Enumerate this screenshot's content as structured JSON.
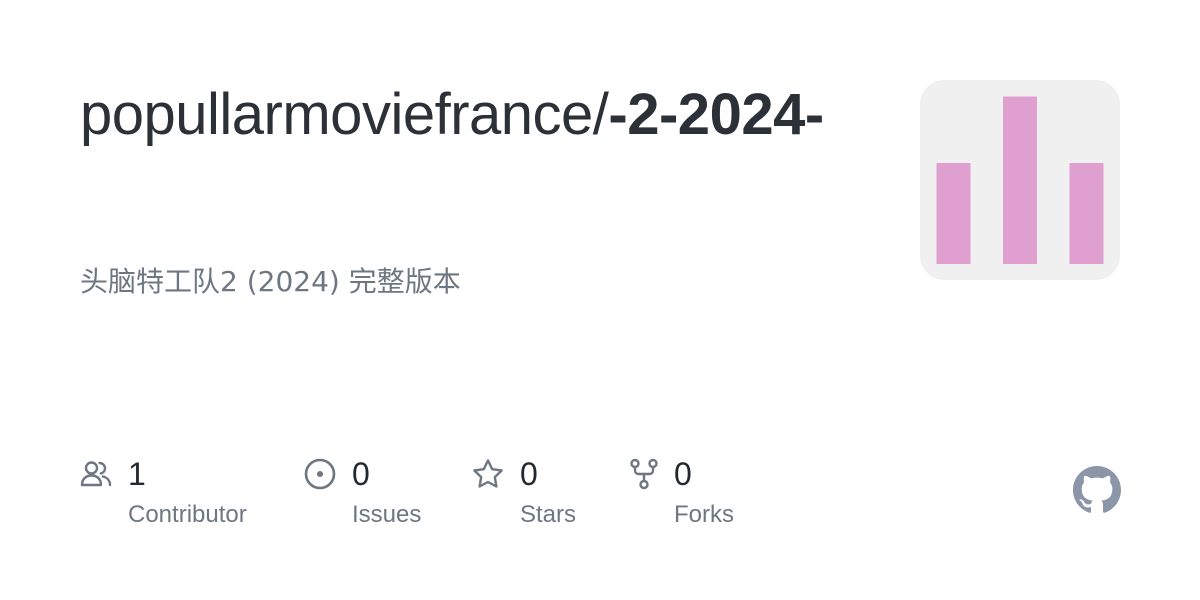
{
  "repo": {
    "owner": "popullarmoviefrance",
    "separator": "/",
    "name": "-2-2024-",
    "description": "头脑特工队2 (2024) 完整版本"
  },
  "avatar": {
    "icon": "bar-graph-avatar",
    "background": "#f0f0f0",
    "bar_color": "#df9fcf"
  },
  "stats": {
    "contributors": {
      "count": "1",
      "label": "Contributor",
      "icon": "people-icon"
    },
    "issues": {
      "count": "0",
      "label": "Issues",
      "icon": "issue-opened-icon"
    },
    "stars": {
      "count": "0",
      "label": "Stars",
      "icon": "star-icon"
    },
    "forks": {
      "count": "0",
      "label": "Forks",
      "icon": "repo-forked-icon"
    }
  },
  "brand": {
    "icon": "github-mark-icon",
    "color": "#8b96a8"
  },
  "colors": {
    "title": "#2b3137",
    "muted": "#6e7781",
    "icon": "#6e7781"
  }
}
